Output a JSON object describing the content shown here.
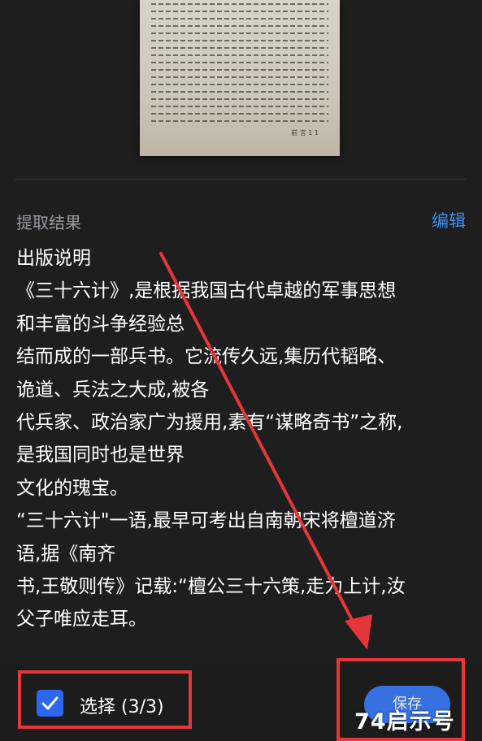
{
  "result": {
    "section_title": "提取结果",
    "edit_label": "编辑",
    "lines": [
      "出版说明",
      "《三十六计》,是根据我国古代卓越的军事思想",
      "和丰富的斗争经验总",
      "结而成的一部兵书。它流传久远,集历代韬略、",
      "诡道、兵法之大成,被各",
      "代兵家、政治家广为援用,素有“谋略奇书”之称,",
      "是我国同时也是世界",
      "文化的瑰宝。",
      "“三十六计\"一语,最早可考出自南朝宋将檀道济",
      "语,据《南齐",
      "书,王敬则传》记载:“檀公三十六策,走为上计,汝",
      "父子唯应走耳。"
    ]
  },
  "bottom_bar": {
    "select_label": "选择 (3/3)",
    "checkbox_checked": true,
    "save_label": "保存"
  },
  "thumbnail": {
    "page_number": "前 言 1 1"
  },
  "watermark": "74启示号",
  "colors": {
    "accent": "#3f8cf0",
    "highlight_box": "#e5363a",
    "checkbox": "#2c67f2",
    "background": "#1e1e1f"
  }
}
